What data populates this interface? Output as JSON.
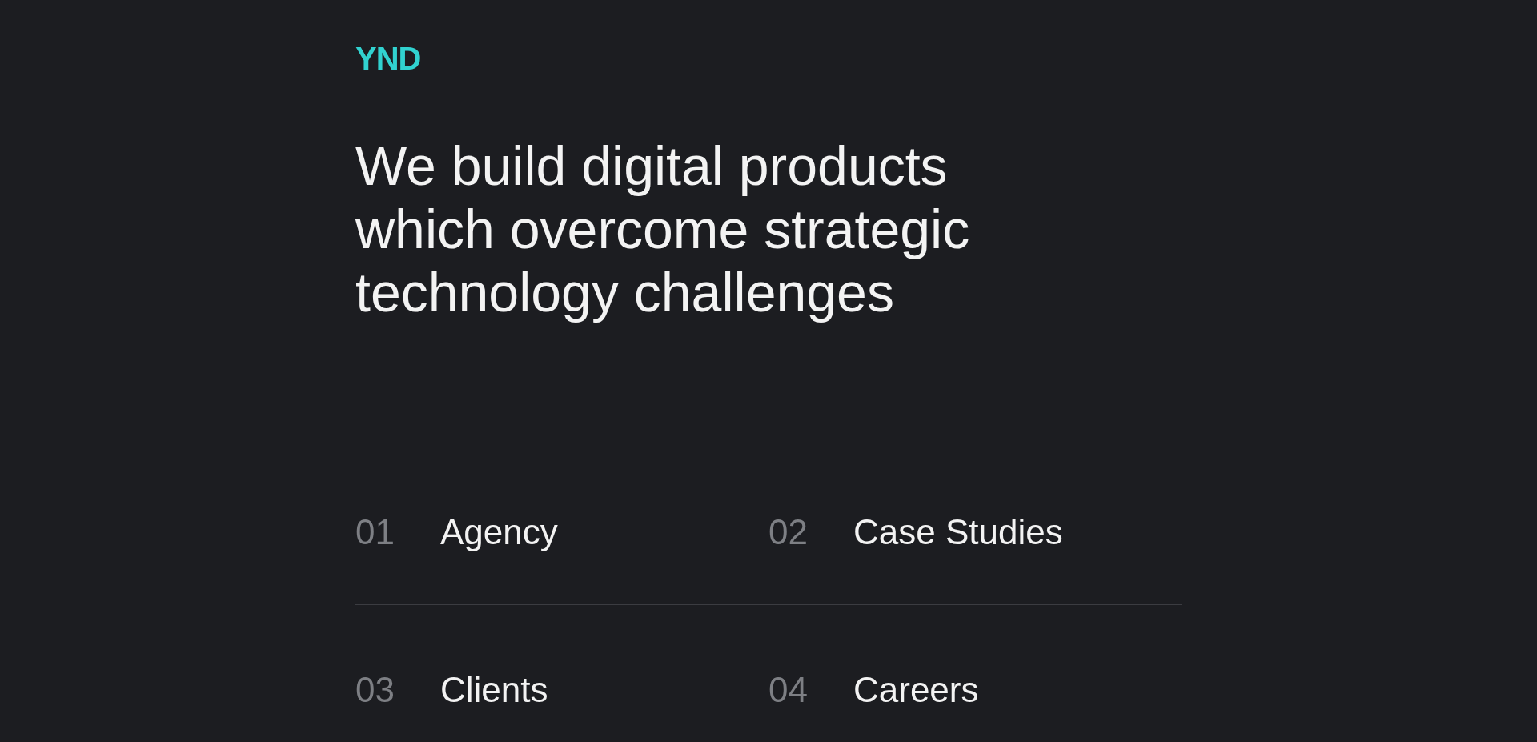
{
  "logo": {
    "text": "YND"
  },
  "headline": "We build digital products which overcome strategic technology challenges",
  "nav": {
    "items": [
      {
        "number": "01",
        "label": "Agency"
      },
      {
        "number": "02",
        "label": "Case Studies"
      },
      {
        "number": "03",
        "label": "Clients"
      },
      {
        "number": "04",
        "label": "Careers"
      }
    ]
  }
}
